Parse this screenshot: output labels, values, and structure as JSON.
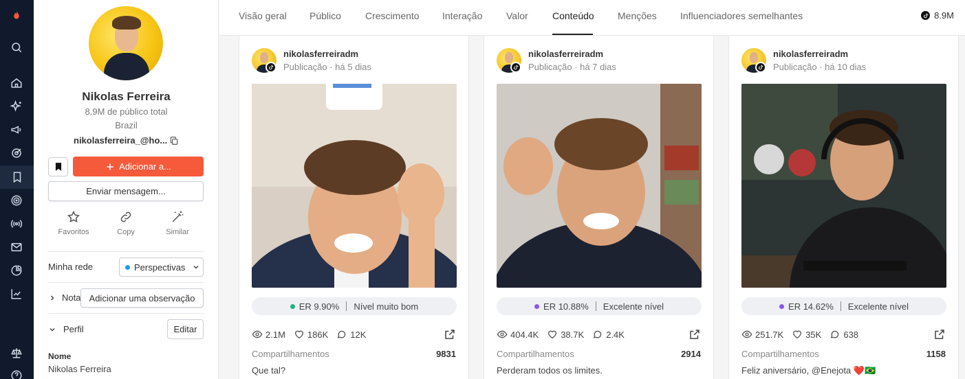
{
  "rail": {
    "items": [
      "flame-logo-icon",
      "search-icon",
      "home-icon",
      "sparkles-icon",
      "megaphone-icon",
      "target-icon",
      "bookmark-icon",
      "radar-icon",
      "broadcast-icon",
      "mail-icon",
      "pie-chart-icon",
      "trend-chart-icon",
      "scale-icon",
      "help-icon"
    ],
    "active": "bookmark-icon"
  },
  "profile": {
    "name": "Nikolas Ferreira",
    "audience": "8.9M de público total",
    "country": "Brazil",
    "email": "nikolasferreira_@ho...",
    "add_label": "Adicionar a...",
    "message_label": "Enviar mensagem...",
    "actions": [
      {
        "label": "Favoritos",
        "icon": "star-icon"
      },
      {
        "label": "Copy",
        "icon": "link-icon"
      },
      {
        "label": "Similar",
        "icon": "magic-wand-icon"
      }
    ],
    "network_label": "Minha rede",
    "network_value": "Perspectivas",
    "notes_label": "Nota",
    "add_note_label": "Adicionar uma observação",
    "perfil_label": "Perfil",
    "edit_label": "Editar",
    "field_name_label": "Nome",
    "field_name_value": "Nikolas Ferreira"
  },
  "tabs": {
    "items": [
      "Visão geral",
      "Público",
      "Crescimento",
      "Interação",
      "Valor",
      "Conteúdo",
      "Menções",
      "Influenciadores semelhantes"
    ],
    "active": "Conteúdo",
    "followers": "8.9M"
  },
  "colors": {
    "accent": "#f55a3a",
    "rail": "#101a2c",
    "er_good": "#22b07d",
    "er_excellent": "#8a56e8"
  },
  "posts": [
    {
      "username": "nikolasferreiradm",
      "meta": "Publicação · há 5 dias",
      "er": "ER 9.90%",
      "level": "Nível muito bom",
      "er_color": "#22b07d",
      "views": "2.1M",
      "likes": "186K",
      "comments": "12K",
      "shares_label": "Compartilhamentos",
      "shares": "9831",
      "caption": "Que tal?"
    },
    {
      "username": "nikolasferreiradm",
      "meta": "Publicação · há 7 dias",
      "er": "ER 10.88%",
      "level": "Excelente nível",
      "er_color": "#8a56e8",
      "views": "404.4K",
      "likes": "38.7K",
      "comments": "2.4K",
      "shares_label": "Compartilhamentos",
      "shares": "2914",
      "caption": "Perderam todos os limites."
    },
    {
      "username": "nikolasferreiradm",
      "meta": "Publicação · há 10 dias",
      "er": "ER 14.62%",
      "level": "Excelente nível",
      "er_color": "#8a56e8",
      "views": "251.7K",
      "likes": "35K",
      "comments": "638",
      "shares_label": "Compartilhamentos",
      "shares": "1158",
      "caption": "Feliz aniversário, @Enejota ❤️🇧🇷"
    }
  ]
}
